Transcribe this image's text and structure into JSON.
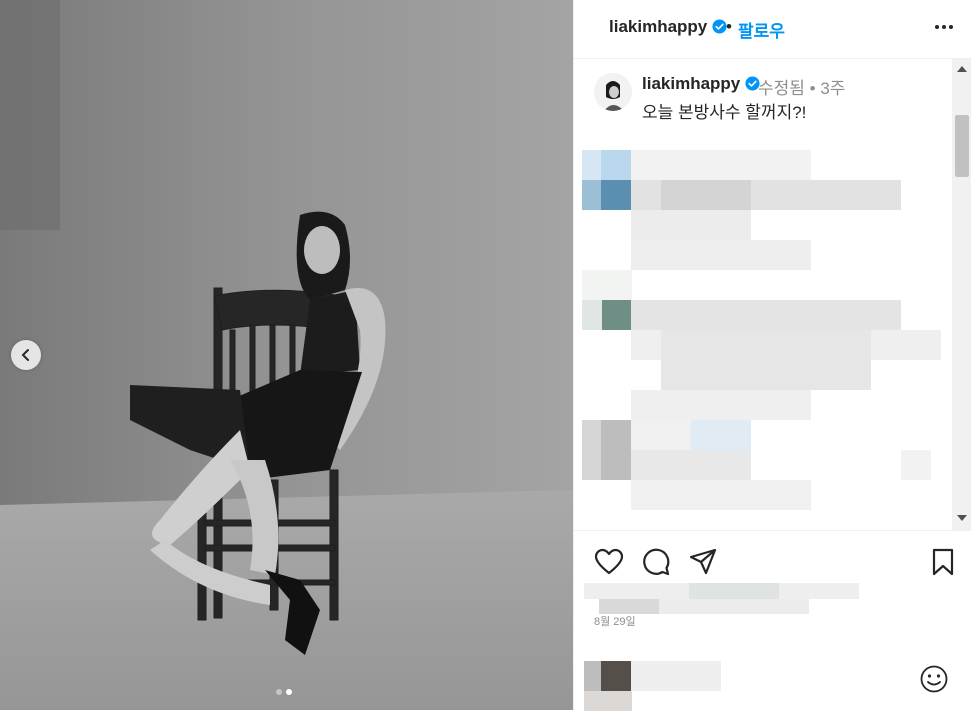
{
  "post": {
    "username": "liakimhappy",
    "follow_label": "팔로우",
    "separator": "•",
    "caption_meta": "수정됨 • 3주",
    "caption_text": "오늘 본방사수 할꺼지?!",
    "date": "8월 29일"
  },
  "carousel": {
    "total_slides": 2,
    "active_slide": 2
  },
  "icons": {
    "verified": "verified-badge-icon",
    "more": "more-options-icon",
    "prev": "chevron-left-icon",
    "like": "heart-icon",
    "comment": "comment-bubble-icon",
    "share": "paper-plane-icon",
    "save": "bookmark-icon",
    "emoji": "emoji-smile-icon"
  },
  "colors": {
    "accent": "#0095f6",
    "verified": "#0095f6",
    "text": "#262626",
    "muted": "#8e8e8e"
  }
}
